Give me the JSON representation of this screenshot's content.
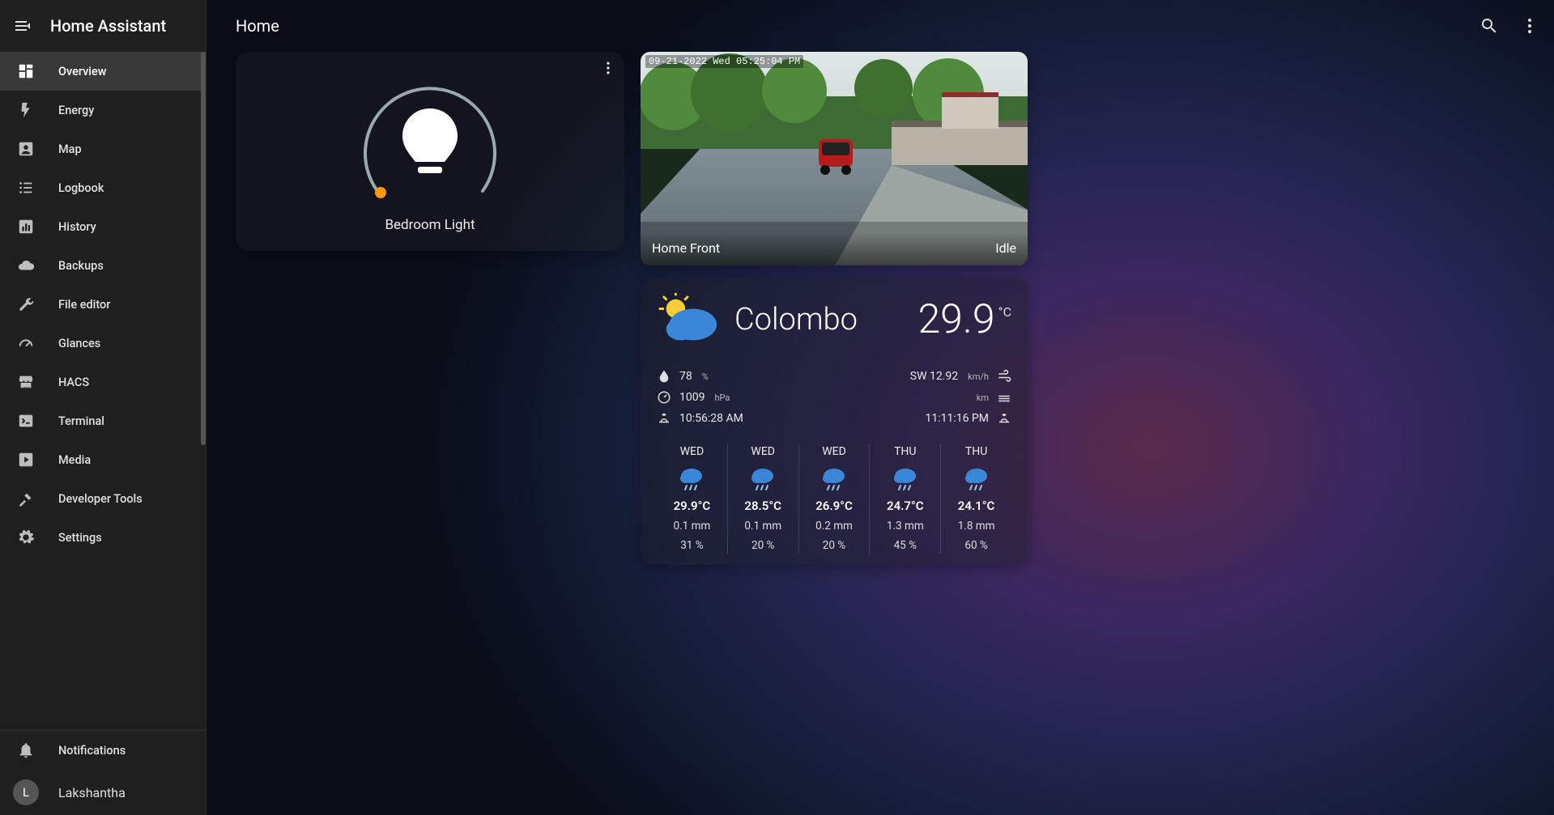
{
  "app": {
    "title": "Home Assistant",
    "pageTitle": "Home"
  },
  "sidebar": {
    "items": [
      {
        "label": "Overview",
        "icon": "dashboard-icon",
        "active": true
      },
      {
        "label": "Energy",
        "icon": "flash-icon"
      },
      {
        "label": "Map",
        "icon": "account-box-icon"
      },
      {
        "label": "Logbook",
        "icon": "list-icon"
      },
      {
        "label": "History",
        "icon": "chart-box-icon"
      },
      {
        "label": "Backups",
        "icon": "cloud-icon"
      },
      {
        "label": "File editor",
        "icon": "wrench-icon"
      },
      {
        "label": "Glances",
        "icon": "gauge-icon"
      },
      {
        "label": "HACS",
        "icon": "store-icon"
      },
      {
        "label": "Terminal",
        "icon": "terminal-icon"
      },
      {
        "label": "Media",
        "icon": "play-box-icon"
      },
      {
        "label": "Developer Tools",
        "icon": "hammer-icon"
      },
      {
        "label": "Settings",
        "icon": "gear-icon"
      }
    ],
    "notifications": {
      "label": "Notifications",
      "icon": "bell-icon"
    },
    "user": {
      "name": "Lakshantha",
      "initial": "L"
    }
  },
  "light": {
    "name": "Bedroom Light",
    "slider_color": "#ffa726"
  },
  "camera": {
    "name": "Home Front",
    "status": "Idle",
    "timestamp": "09-21-2022 Wed 05:25:04 PM"
  },
  "weather": {
    "city": "Colombo",
    "temperature": "29.9",
    "unit": "°C",
    "humidity": "78",
    "humidity_unit": "%",
    "pressure": "1009",
    "pressure_unit": "hPa",
    "sunrise": "10:56:28 AM",
    "wind": "SW 12.92",
    "wind_unit": "km/h",
    "visibility": "",
    "visibility_unit": "km",
    "sunset": "11:11:16 PM",
    "forecast": [
      {
        "day": "WED",
        "temp": "29.9°C",
        "precip": "0.1 mm",
        "pop": "31 %"
      },
      {
        "day": "WED",
        "temp": "28.5°C",
        "precip": "0.1 mm",
        "pop": "20 %"
      },
      {
        "day": "WED",
        "temp": "26.9°C",
        "precip": "0.2 mm",
        "pop": "20 %"
      },
      {
        "day": "THU",
        "temp": "24.7°C",
        "precip": "1.3 mm",
        "pop": "45 %"
      },
      {
        "day": "THU",
        "temp": "24.1°C",
        "precip": "1.8 mm",
        "pop": "60 %"
      }
    ]
  },
  "colors": {
    "accent": "#03a9f4",
    "slider_dot": "#ff9800"
  }
}
